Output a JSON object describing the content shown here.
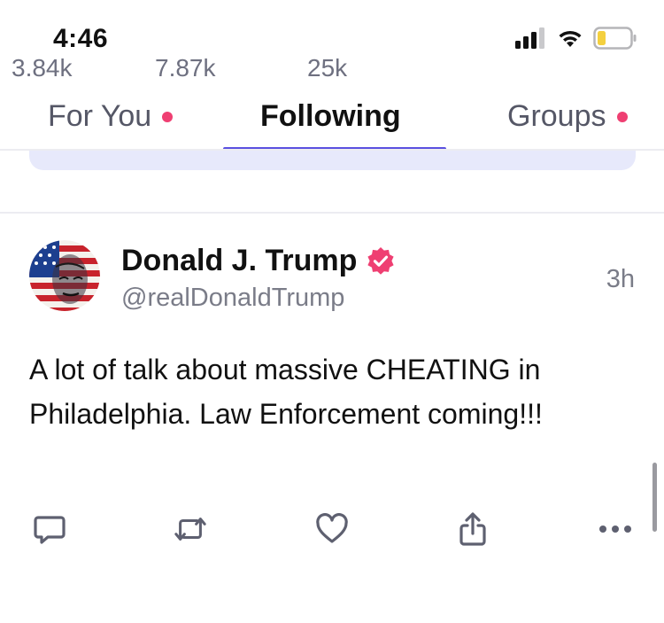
{
  "status_bar": {
    "time": "4:46"
  },
  "tabs": [
    {
      "label": "For You",
      "has_dot": true
    },
    {
      "label": "Following",
      "active": true
    },
    {
      "label": "Groups",
      "has_dot": true
    }
  ],
  "post": {
    "author_name": "Donald J. Trump",
    "handle": "@realDonaldTrump",
    "time": "3h",
    "body": "A lot of talk about massive CHEATING in Philadelphia. Law Enforcement coming!!!",
    "actions": {
      "reply_count": "3.84k",
      "retruth_count": "7.87k",
      "like_count": "25k"
    }
  },
  "colors": {
    "accent": "#5a50e0",
    "badge": "#ef3f72",
    "muted_text": "#7a7c88"
  }
}
